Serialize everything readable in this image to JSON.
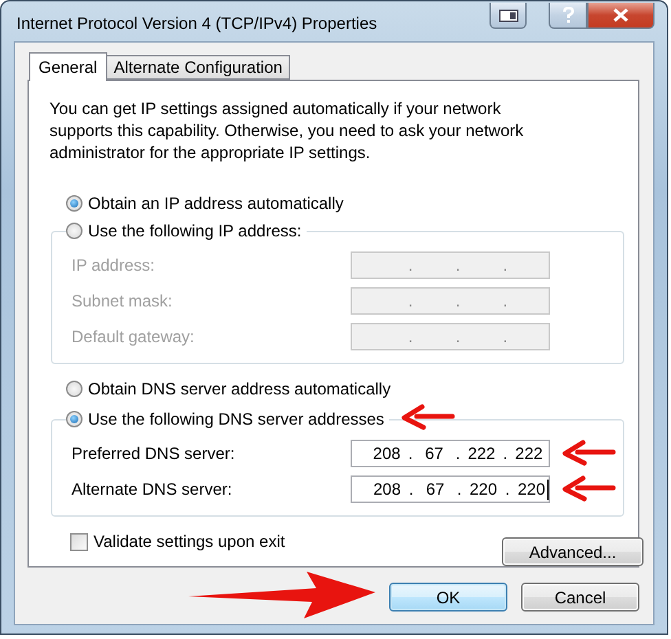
{
  "window": {
    "title": "Internet Protocol Version 4 (TCP/IPv4) Properties"
  },
  "tabs": [
    {
      "label": "General",
      "selected": true
    },
    {
      "label": "Alternate Configuration",
      "selected": false
    }
  ],
  "intro": "You can get IP settings assigned automatically if your network supports this capability. Otherwise, you need to ask your network administrator for the appropriate IP settings.",
  "ip_options": [
    {
      "label": "Obtain an IP address automatically",
      "selected": true,
      "annotated": false
    },
    {
      "label": "Use the following IP address:",
      "selected": false,
      "annotated": false
    }
  ],
  "ip_fields": [
    {
      "label": "IP address:",
      "disabled": true,
      "focused": false,
      "annotated": false,
      "dots": [
        ".",
        ".",
        "."
      ]
    },
    {
      "label": "Subnet mask:",
      "disabled": true,
      "focused": false,
      "annotated": false,
      "dots": [
        ".",
        ".",
        "."
      ]
    },
    {
      "label": "Default gateway:",
      "disabled": true,
      "focused": false,
      "annotated": false,
      "dots": [
        ".",
        ".",
        "."
      ]
    }
  ],
  "dns_options": [
    {
      "label": "Obtain DNS server address automatically",
      "selected": false,
      "annotated": false
    },
    {
      "label": "Use the following DNS server addresses",
      "selected": true,
      "annotated": true
    }
  ],
  "dns_fields": [
    {
      "label": "Preferred DNS server:",
      "disabled": false,
      "focused": false,
      "annotated": true,
      "octets": [
        "208",
        "67",
        "222",
        "222"
      ],
      "dots": [
        ".",
        ".",
        "."
      ]
    },
    {
      "label": "Alternate DNS server:",
      "disabled": false,
      "focused": true,
      "annotated": true,
      "octets": [
        "208",
        "67",
        "220",
        "220"
      ],
      "dots": [
        ".",
        ".",
        "."
      ]
    }
  ],
  "validate": {
    "label": "Validate settings upon exit",
    "checked": false
  },
  "advanced_button": "Advanced...",
  "buttons": [
    {
      "label": "OK",
      "default": true,
      "annotated": true
    },
    {
      "label": "Cancel",
      "default": false,
      "annotated": false
    }
  ]
}
